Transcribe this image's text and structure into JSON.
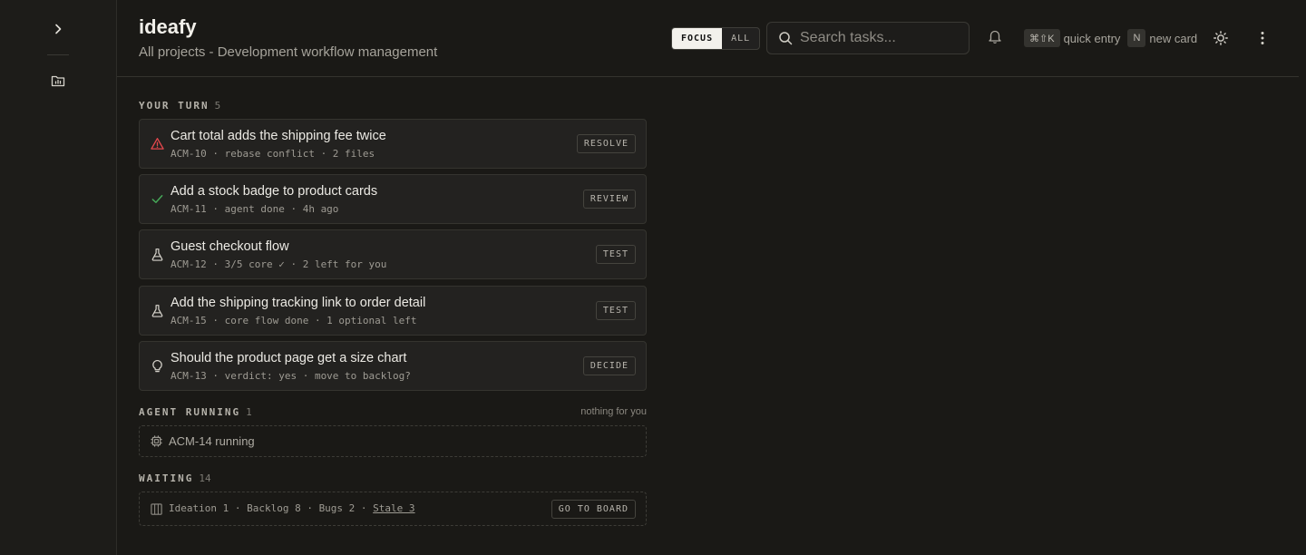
{
  "app": {
    "title": "ideafy",
    "subtitle": "All projects - Development workflow management"
  },
  "header": {
    "focus_label": "FOCUS",
    "all_label": "ALL",
    "search_placeholder": "Search tasks...",
    "quick_entry_key": "⌘⇧K",
    "quick_entry_label": "quick entry",
    "new_card_key": "N",
    "new_card_label": "new card"
  },
  "sidebar": {
    "icons": [
      "chevron-right-icon",
      "folder-chart-icon"
    ]
  },
  "your_turn": {
    "label": "YOUR TURN",
    "count": "5",
    "cards": [
      {
        "title": "Cart total adds the shipping fee twice",
        "meta": "ACM-10 · rebase conflict · 2 files",
        "tag": "RESOLVE",
        "icon": "warning-triangle-icon",
        "icon_color": "#e5484d"
      },
      {
        "title": "Add a stock badge to product cards",
        "meta": "ACM-11 · agent done · 4h ago",
        "tag": "REVIEW",
        "icon": "check-icon",
        "icon_color": "#46a758"
      },
      {
        "title": "Guest checkout flow",
        "meta": "ACM-12 · 3/5 core ✓ · 2 left for you",
        "tag": "TEST",
        "icon": "flask-icon",
        "icon_color": "#d6d3cb"
      },
      {
        "title": "Add the shipping tracking link to order detail",
        "meta": "ACM-15 · core flow done · 1 optional left",
        "tag": "TEST",
        "icon": "flask-icon",
        "icon_color": "#d6d3cb"
      },
      {
        "title": "Should the product page get a size chart",
        "meta": "ACM-13 · verdict: yes · move to backlog?",
        "tag": "DECIDE",
        "icon": "lightbulb-icon",
        "icon_color": "#d6d3cb"
      }
    ]
  },
  "agent_running": {
    "label": "AGENT RUNNING",
    "count": "1",
    "note": "nothing for you",
    "item": "ACM-14 running"
  },
  "waiting": {
    "label": "WAITING",
    "count": "14",
    "summary": "Ideation 1 · Backlog 8 · Bugs 2 · ",
    "stale": "Stale 3",
    "button": "GO TO BOARD"
  }
}
